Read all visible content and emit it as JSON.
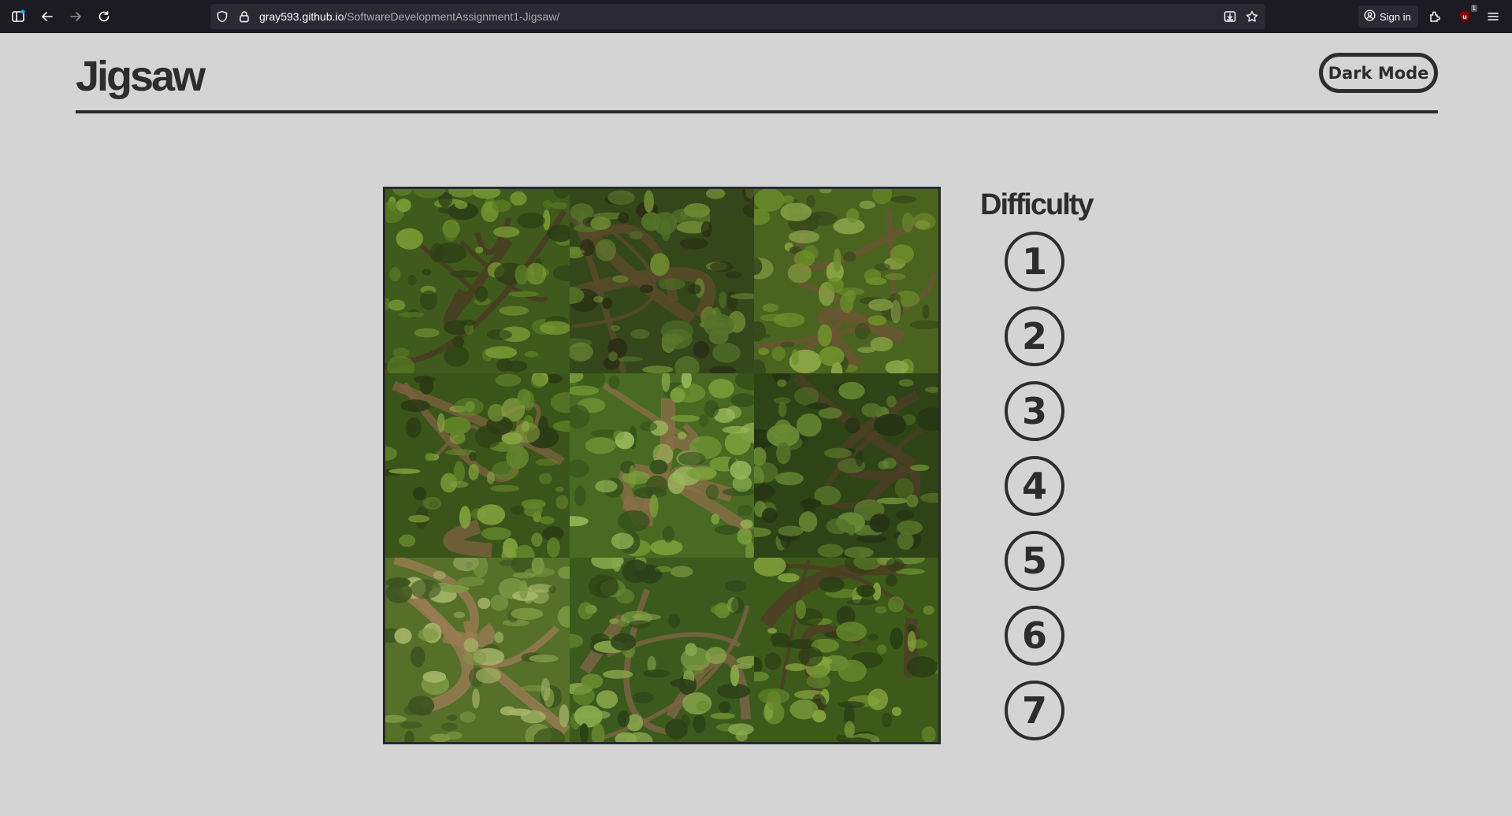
{
  "browser": {
    "url_host": "gray593.github.io",
    "url_path": "/SoftwareDevelopmentAssignment1-Jigsaw/",
    "sign_in_label": "Sign in",
    "extension_badge": "1",
    "toolbar_icons": [
      "sidebar-icon",
      "back-icon",
      "forward-icon",
      "reload-icon",
      "shield-icon",
      "lock-icon",
      "save-to-pocket-icon",
      "star-icon",
      "account-icon",
      "extensions-icon",
      "ublock-icon",
      "menu-icon"
    ]
  },
  "header": {
    "title": "Jigsaw",
    "dark_mode_label": "Dark Mode"
  },
  "puzzle": {
    "rows": 3,
    "cols": 3,
    "tiles": [
      "tile-1",
      "tile-2",
      "tile-3",
      "tile-4",
      "tile-5",
      "tile-6",
      "tile-7",
      "tile-8",
      "tile-9"
    ]
  },
  "difficulty": {
    "title": "Difficulty",
    "levels": [
      "1",
      "2",
      "3",
      "4",
      "5",
      "6",
      "7"
    ]
  },
  "colors": {
    "page_background": "#d4d4d4",
    "text": "#2d2d2d",
    "browser_chrome": "#1c1b22",
    "url_bar": "#2b2a33"
  }
}
